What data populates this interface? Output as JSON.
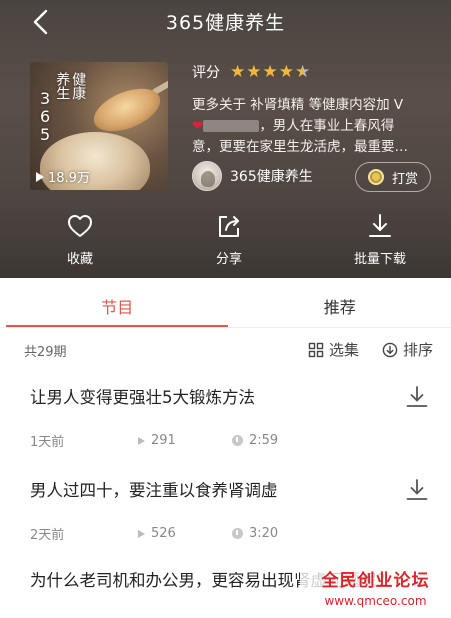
{
  "header": {
    "title": "365健康养生",
    "cover": {
      "vertical_label_chars": [
        "健康",
        "养生"
      ],
      "vertical_label_digits": [
        "3",
        "6",
        "5"
      ],
      "play_count": "18.9万"
    },
    "rating": {
      "label": "评分",
      "stars": 4.5,
      "star_color": "#f4b63f"
    },
    "description": {
      "line1": "更多关于 补肾填精 等健康内容加 V",
      "line2_after_blur": "，男人在事业上春风得",
      "line3": "意，更要在家里生龙活虎，最重要…"
    },
    "author": {
      "name": "365健康养生"
    },
    "tip_button": {
      "label": "打赏"
    },
    "actions": {
      "favorite": "收藏",
      "share": "分享",
      "batch_download": "批量下载"
    }
  },
  "tabs": [
    {
      "label": "节目",
      "active": true
    },
    {
      "label": "推荐",
      "active": false
    }
  ],
  "list_header": {
    "count": "共29期",
    "select_label": "选集",
    "sort_label": "排序"
  },
  "episodes": [
    {
      "title": "让男人变得更强壮5大锻炼方法",
      "time": "1天前",
      "plays": "291",
      "duration": "2:59"
    },
    {
      "title": "男人过四十，要注重以食养肾调虚",
      "time": "2天前",
      "plays": "526",
      "duration": "3:20"
    },
    {
      "title": "为什么老司机和办公男，更容易出现肾虚问题呢？"
    }
  ],
  "watermark": {
    "line1": "全民创业论坛",
    "line2": "www.qmceo.com"
  },
  "colors": {
    "accent": "#e0584c",
    "header_bg": "#4f4742"
  }
}
